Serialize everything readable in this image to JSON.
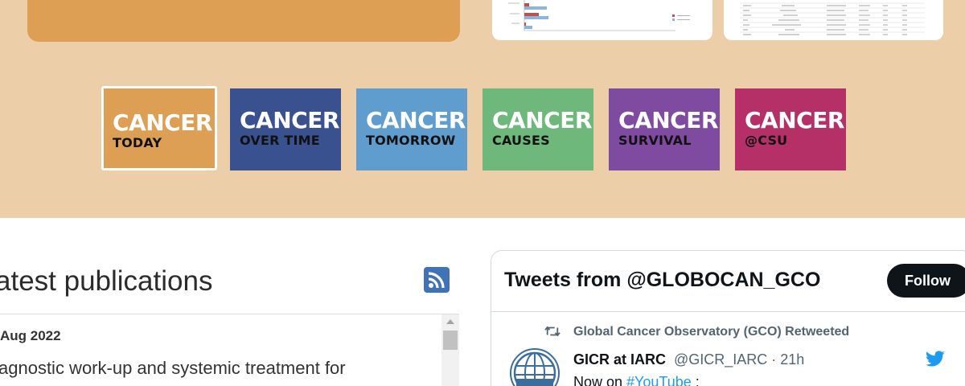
{
  "colors": {
    "band": "#eccfa8",
    "today": "#dc9f54",
    "over_time": "#3a5190",
    "tomorrow": "#5f9dce",
    "causes": "#6db87a",
    "survival": "#7f4ba0",
    "csu": "#b53066",
    "twitter_blue": "#1d9bf0"
  },
  "tiles": [
    {
      "line1": "CANCER",
      "line2": "TODAY",
      "color": "#dc9f54",
      "selected": true
    },
    {
      "line1": "CANCER",
      "line2": "OVER TIME",
      "color": "#3a5190",
      "selected": false
    },
    {
      "line1": "CANCER",
      "line2": "TOMORROW",
      "color": "#5f9dce",
      "selected": false
    },
    {
      "line1": "CANCER",
      "line2": "CAUSES",
      "color": "#6db87a",
      "selected": false
    },
    {
      "line1": "CANCER",
      "line2": "SURVIVAL",
      "color": "#7f4ba0",
      "selected": false
    },
    {
      "line1": "CANCER",
      "line2": "@CSU",
      "color": "#b53066",
      "selected": false
    }
  ],
  "publications": {
    "title": "atest publications",
    "rss_icon": "rss-icon",
    "date": "Aug 2022",
    "text": "agnostic work-up and systemic treatment for"
  },
  "twitter": {
    "title": "Tweets from @GLOBOCAN_GCO",
    "follow_label": "Follow",
    "retweet_label": "Global Cancer Observatory (GCO) Retweeted",
    "name": "GICR at IARC",
    "handle": "@GICR_IARC · 21h",
    "body_prefix": "Now on ",
    "hashtag": "#YouTube",
    "body_suffix": " :"
  }
}
